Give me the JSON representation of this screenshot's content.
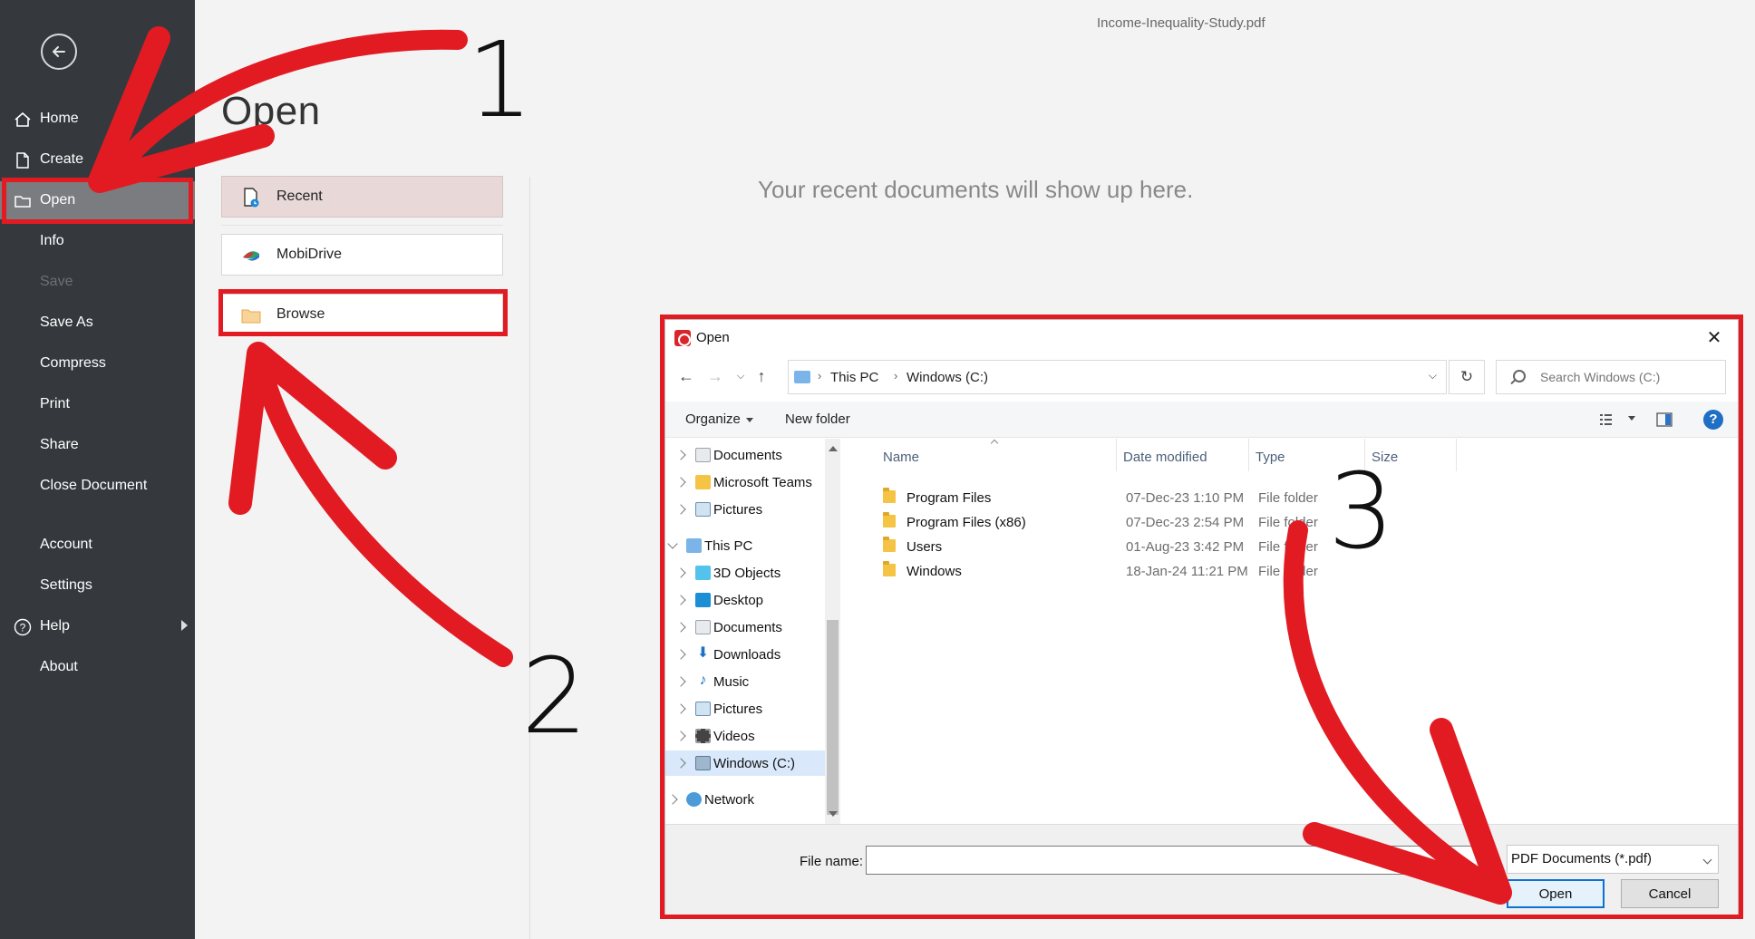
{
  "document_title": "Income-Inequality-Study.pdf",
  "sidebar": {
    "back_icon": "arrow-left-icon",
    "items": [
      {
        "label": "Home",
        "icon": "home-icon",
        "state": "normal"
      },
      {
        "label": "Create",
        "icon": "file-icon",
        "state": "normal"
      },
      {
        "label": "Open",
        "icon": "folder-icon",
        "state": "active"
      },
      {
        "label": "Info",
        "state": "normal"
      },
      {
        "label": "Save",
        "state": "disabled"
      },
      {
        "label": "Save As",
        "state": "normal"
      },
      {
        "label": "Compress",
        "state": "normal"
      },
      {
        "label": "Print",
        "state": "normal"
      },
      {
        "label": "Share",
        "state": "normal"
      },
      {
        "label": "Close Document",
        "state": "normal"
      },
      {
        "label": "Account",
        "state": "normal"
      },
      {
        "label": "Settings",
        "state": "normal"
      },
      {
        "label": "Help",
        "icon": "help-circle-icon",
        "state": "normal",
        "submenu": true
      },
      {
        "label": "About",
        "state": "normal"
      }
    ]
  },
  "open_panel": {
    "title": "Open",
    "locations": [
      {
        "label": "Recent",
        "icon": "recent-file-icon",
        "selected": true
      },
      {
        "label": "MobiDrive",
        "icon": "mobidrive-icon",
        "selected": false
      },
      {
        "label": "Browse",
        "icon": "folder-icon",
        "selected": false
      }
    ],
    "recent_empty_message": "Your recent documents will show up here."
  },
  "dialog": {
    "title": "Open",
    "close_icon": "close-icon",
    "address": {
      "crumbs": [
        "This PC",
        "Windows (C:)"
      ]
    },
    "search_placeholder": "Search Windows (C:)",
    "commands": {
      "organize": "Organize",
      "new_folder": "New folder"
    },
    "tree": [
      {
        "label": "Documents",
        "icon": "documents-icon",
        "level": 1,
        "expander": "closed"
      },
      {
        "label": "Microsoft Teams",
        "icon": "folder-icon",
        "level": 1,
        "expander": "closed"
      },
      {
        "label": "Pictures",
        "icon": "pictures-icon",
        "level": 1,
        "expander": "closed"
      },
      {
        "label": "This PC",
        "icon": "computer-icon",
        "level": 0,
        "expander": "open"
      },
      {
        "label": "3D Objects",
        "icon": "3d-objects-icon",
        "level": 1,
        "expander": "closed"
      },
      {
        "label": "Desktop",
        "icon": "desktop-icon",
        "level": 1,
        "expander": "closed"
      },
      {
        "label": "Documents",
        "icon": "documents-icon",
        "level": 1,
        "expander": "closed"
      },
      {
        "label": "Downloads",
        "icon": "download-icon",
        "level": 1,
        "expander": "closed"
      },
      {
        "label": "Music",
        "icon": "music-icon",
        "level": 1,
        "expander": "closed"
      },
      {
        "label": "Pictures",
        "icon": "pictures-icon",
        "level": 1,
        "expander": "closed"
      },
      {
        "label": "Videos",
        "icon": "videos-icon",
        "level": 1,
        "expander": "closed"
      },
      {
        "label": "Windows (C:)",
        "icon": "drive-icon",
        "level": 1,
        "expander": "closed",
        "selected": true
      },
      {
        "label": "Network",
        "icon": "network-icon",
        "level": 0,
        "expander": "closed"
      }
    ],
    "columns": {
      "name": "Name",
      "date_modified": "Date modified",
      "type": "Type",
      "size": "Size"
    },
    "files": [
      {
        "name": "Program Files",
        "date": "07-Dec-23 1:10 PM",
        "type": "File folder"
      },
      {
        "name": "Program Files (x86)",
        "date": "07-Dec-23 2:54 PM",
        "type": "File folder"
      },
      {
        "name": "Users",
        "date": "01-Aug-23 3:42 PM",
        "type": "File folder"
      },
      {
        "name": "Windows",
        "date": "18-Jan-24 11:21 PM",
        "type": "File folder"
      }
    ],
    "file_name_label": "File name:",
    "file_name_value": "",
    "file_type": "PDF Documents (*.pdf)",
    "open_button": "Open",
    "cancel_button": "Cancel"
  },
  "annotations": {
    "steps": [
      "1",
      "2",
      "3"
    ],
    "color": "#e21b23"
  }
}
